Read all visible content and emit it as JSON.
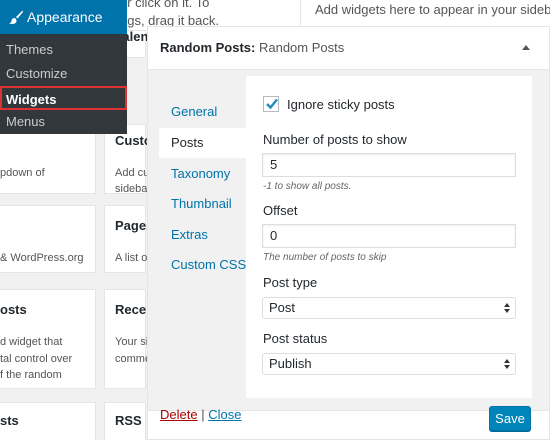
{
  "admin_menu": {
    "section_title": "Appearance",
    "items": [
      {
        "label": "Themes"
      },
      {
        "label": "Customize"
      },
      {
        "label": "Widgets",
        "active": true
      },
      {
        "label": "Menus"
      }
    ],
    "colors": {
      "menu_bg": "#32373c",
      "head_bg": "#0073aa",
      "highlight": "#dc3232"
    }
  },
  "background": {
    "top_text": [
      "or click on it. To",
      "ngs, drag it back."
    ],
    "sidebar_hint": "Add widgets here to appear in your sidebar.",
    "tiles": [
      {
        "title": "Calen",
        "desc": []
      },
      {
        "title": "",
        "desc": [
          "pdown of"
        ]
      },
      {
        "title": "Custo",
        "desc": [
          "Add custo",
          "sideba"
        ]
      },
      {
        "title": "",
        "desc": [
          "& WordPress.org"
        ]
      },
      {
        "title": "Pages",
        "desc": [
          "A list o"
        ]
      },
      {
        "title": "osts",
        "desc": [
          "d widget that",
          "tal control over",
          "f the random"
        ]
      },
      {
        "title": "Recer",
        "desc": [
          "Your si",
          "comme"
        ]
      },
      {
        "title": "sts",
        "desc": []
      },
      {
        "title": "RSS",
        "desc": []
      }
    ]
  },
  "widget": {
    "title": "Random Posts:",
    "subtitle": "Random Posts",
    "tabs": [
      {
        "label": "General"
      },
      {
        "label": "Posts",
        "active": true
      },
      {
        "label": "Taxonomy"
      },
      {
        "label": "Thumbnail"
      },
      {
        "label": "Extras"
      },
      {
        "label": "Custom CSS"
      }
    ],
    "ignore_sticky": {
      "label": "Ignore sticky posts",
      "checked": true
    },
    "num_posts": {
      "label": "Number of posts to show",
      "value": "5",
      "hint": "-1 to show all posts."
    },
    "offset": {
      "label": "Offset",
      "value": "0",
      "hint": "The number of posts to skip"
    },
    "post_type": {
      "label": "Post type",
      "selected": "Post"
    },
    "post_status": {
      "label": "Post status",
      "selected": "Publish"
    },
    "delete_label": "Delete",
    "separator": "|",
    "close_label": "Close",
    "save_label": "Save"
  }
}
